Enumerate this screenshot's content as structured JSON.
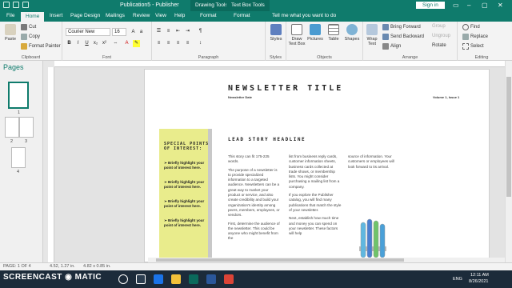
{
  "titlebar": {
    "doc_title": "Publication5 - Publisher",
    "context_tabs": [
      "Drawing Tools",
      "Text Box Tools"
    ],
    "sign_in": "Sign in",
    "minimize": "–",
    "restore": "▢",
    "close": "✕"
  },
  "tabs": [
    "File",
    "Home",
    "Insert",
    "Page Design",
    "Mailings",
    "Review",
    "View",
    "Help",
    "Format",
    "Format"
  ],
  "tell_me": "Tell me what you want to do",
  "ribbon": {
    "clipboard": {
      "paste": "Paste",
      "cut": "Cut",
      "copy": "Copy",
      "format_painter": "Format Painter",
      "label": "Clipboard"
    },
    "font": {
      "family": "Courier New",
      "size": "16",
      "label": "Font"
    },
    "paragraph": {
      "label": "Paragraph"
    },
    "styles": {
      "btn": "Styles",
      "label": "Styles"
    },
    "objects": {
      "draw_text_box": "Draw Text Box",
      "pictures": "Pictures",
      "table": "Table",
      "shapes": "Shapes",
      "label": "Objects"
    },
    "wrap": {
      "wrap_text": "Wrap Text"
    },
    "arrange": {
      "bring_forward": "Bring Forward",
      "send_backward": "Send Backward",
      "align": "Align",
      "group": "Group",
      "ungroup": "Ungroup",
      "rotate": "Rotate",
      "label": "Arrange"
    },
    "editing": {
      "find": "Find",
      "replace": "Replace",
      "select": "Select",
      "label": "Editing"
    }
  },
  "pages_pane": {
    "title": "Pages",
    "thumbs": [
      "1",
      "2",
      "3",
      "4"
    ]
  },
  "newsletter": {
    "title": "NEWSLETTER TITLE",
    "date": "Newsletter Date",
    "volume": "Volume 1, Issue 1",
    "sidebar_head": "SPECIAL POINTS OF INTEREST:",
    "bullets": [
      "Briefly highlight your point of interest here.",
      "Briefly highlight your point of interest here.",
      "Briefly highlight your point of interest here.",
      "Briefly highlight your point of interest here."
    ],
    "lead": "LEAD STORY HEADLINE",
    "col1": [
      "This story can fit 175-225 words.",
      "The purpose of a newsletter is to provide specialized information to a targeted audience. Newsletters can be a great way to market your product or service, and also create credibility and build your organization's identity among peers, members, employees, or vendors.",
      "First, determine the audience of the newsletter. This could be anyone who might benefit from the"
    ],
    "col2": [
      "list from business reply cards, customer information sheets, business cards collected at trade shows, or membership lists. You might consider purchasing a mailing list from a company.",
      "If you explore the Publisher catalog, you will find many publications that match the style of your newsletter.",
      "Next, establish how much time and money you can spend on your newsletter. These factors will help"
    ],
    "col3": [
      "source of information. Your customers or employees will look forward to its arrival."
    ]
  },
  "statusbar": {
    "page": "PAGE: 1 OF 4",
    "pos": "4.52, 1.27 in.",
    "size": "4.82 x 0.85 in."
  },
  "taskbar": {
    "watermark": "SCREENCAST ◉ MATIC",
    "lang": "ENG",
    "time": "12:11 AM",
    "date": "8/26/2021"
  },
  "colors": {
    "accent": "#0f7b6c",
    "sidebar_fill": "#e9ec8c"
  }
}
